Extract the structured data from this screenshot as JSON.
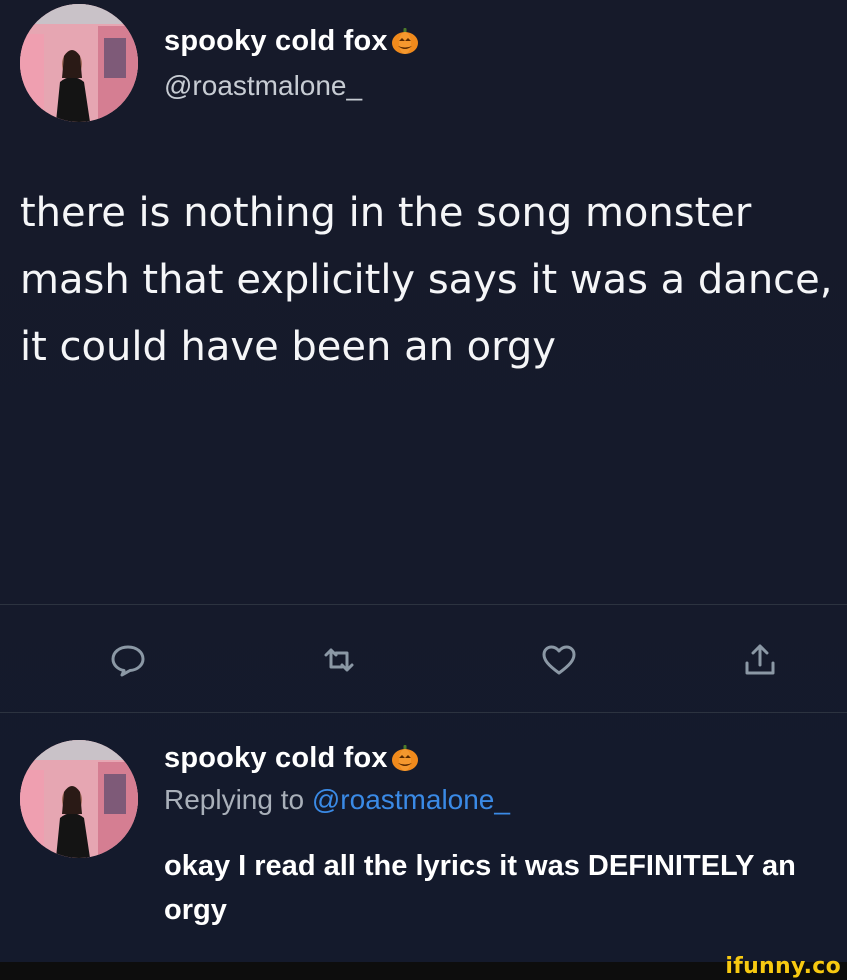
{
  "tweet": {
    "author_name": "spooky cold fox",
    "author_handle": "@roastmalone_",
    "text": "there is nothing in the song monster mash that explicitly says it was a dance, it could have been an orgy",
    "actions": [
      "reply-icon",
      "retweet-icon",
      "like-icon",
      "share-icon"
    ]
  },
  "reply": {
    "author_name": "spooky cold fox",
    "replying_prefix": "Replying to ",
    "replying_to": "@roastmalone_",
    "text": "okay I read all the lyrics it was DEFINITELY an orgy"
  },
  "watermark": "ifunny.co",
  "colors": {
    "background": "#15202b",
    "mention": "#3a8ae6",
    "watermark": "#f7c911",
    "icon": "#8b98a5"
  }
}
